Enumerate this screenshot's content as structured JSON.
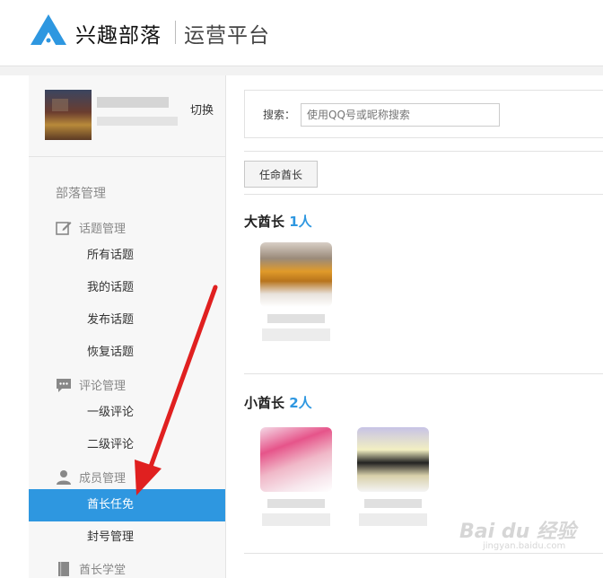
{
  "header": {
    "brand": "兴趣部落",
    "platform": "运营平台"
  },
  "sidebar": {
    "switch_label": "切换",
    "section_title": "部落管理",
    "groups": [
      {
        "label": "话题管理",
        "icon": "edit-icon",
        "items": [
          "所有话题",
          "我的话题",
          "发布话题",
          "恢复话题"
        ]
      },
      {
        "label": "评论管理",
        "icon": "comment-icon",
        "items": [
          "一级评论",
          "二级评论"
        ]
      },
      {
        "label": "成员管理",
        "icon": "person-icon",
        "items": [
          "酋长任免",
          "封号管理"
        ]
      },
      {
        "label": "酋长学堂",
        "icon": "book-icon",
        "items": []
      }
    ],
    "active_item": "酋长任免"
  },
  "main": {
    "search_label": "搜索：",
    "search_placeholder": "使用QQ号或昵称搜索",
    "appoint_button": "任命酋长",
    "big_chief": {
      "title": "大酋长",
      "count": "1人"
    },
    "small_chief": {
      "title": "小酋长",
      "count": "2人"
    }
  },
  "watermark": {
    "text": "Bai du 经验",
    "sub": "jingyan.baidu.com"
  },
  "colors": {
    "accent": "#2e97e0",
    "arrow": "#e02020",
    "logo": "#2e97e0"
  }
}
